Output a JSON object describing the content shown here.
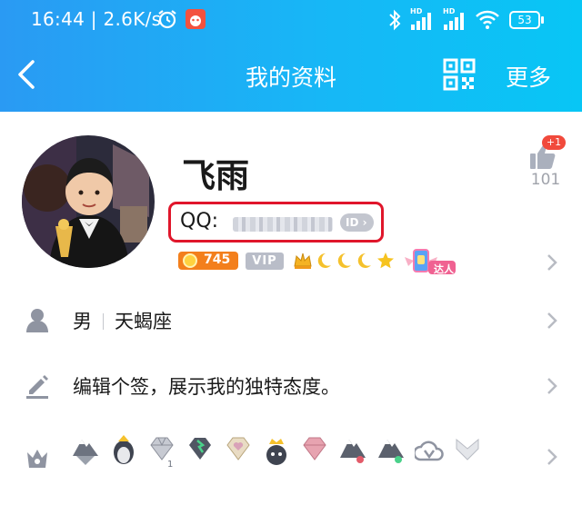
{
  "status_bar": {
    "time_speed": "16:44 | 2.6K/s",
    "signal1_label": "HD",
    "signal2_label": "HD",
    "battery": "53"
  },
  "titlebar": {
    "title": "我的资料",
    "more_label": "更多"
  },
  "profile": {
    "name": "飞雨",
    "qq_label": "QQ:",
    "id_badge": "ID",
    "coin_value": "745",
    "vip_label": "VIP",
    "talent_label": "达人",
    "like_plus": "+1",
    "like_count": "101"
  },
  "rows": {
    "gender": "男",
    "zodiac": "天蝎座",
    "signature": "编辑个签，展示我的独特态度。"
  },
  "colors": {
    "header_start": "#2a9af3",
    "header_end": "#08c6f5",
    "highlight_border": "#e0162b",
    "coin_bg": "#f37f1c"
  }
}
